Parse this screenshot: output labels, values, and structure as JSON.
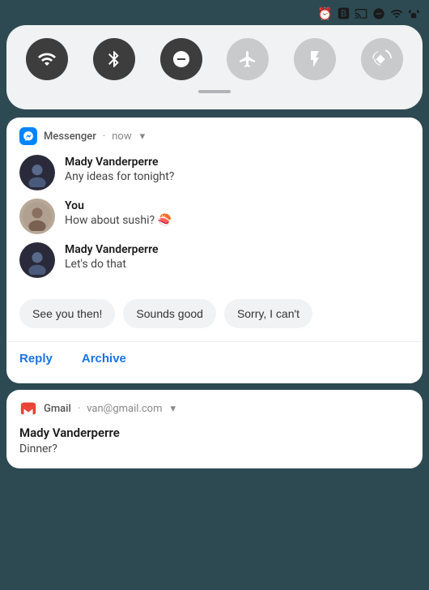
{
  "status_bar": {
    "icons": [
      "alarm",
      "bluetooth",
      "cast",
      "dnd",
      "wifi",
      "signal"
    ]
  },
  "quick_settings": {
    "icons": [
      {
        "name": "wifi",
        "active": true
      },
      {
        "name": "bluetooth",
        "active": true
      },
      {
        "name": "dnd",
        "active": true
      },
      {
        "name": "airplane",
        "active": false
      },
      {
        "name": "flashlight",
        "active": false
      },
      {
        "name": "rotate",
        "active": false
      }
    ]
  },
  "messenger_notification": {
    "app_name": "Messenger",
    "time": "now",
    "messages": [
      {
        "sender": "Mady Vanderperre",
        "text": "Any ideas for tonight?",
        "avatar_type": "dark"
      },
      {
        "sender": "You",
        "text": "How about sushi? 🍣",
        "avatar_type": "light"
      },
      {
        "sender": "Mady Vanderperre",
        "text": "Let's do that",
        "avatar_type": "dark"
      }
    ],
    "quick_replies": [
      "See you then!",
      "Sounds good",
      "Sorry, I can't"
    ],
    "actions": [
      "Reply",
      "Archive"
    ]
  },
  "gmail_notification": {
    "app_name": "Gmail",
    "account": "van@gmail.com",
    "sender": "Mady Vanderperre",
    "subject": "Dinner?"
  }
}
